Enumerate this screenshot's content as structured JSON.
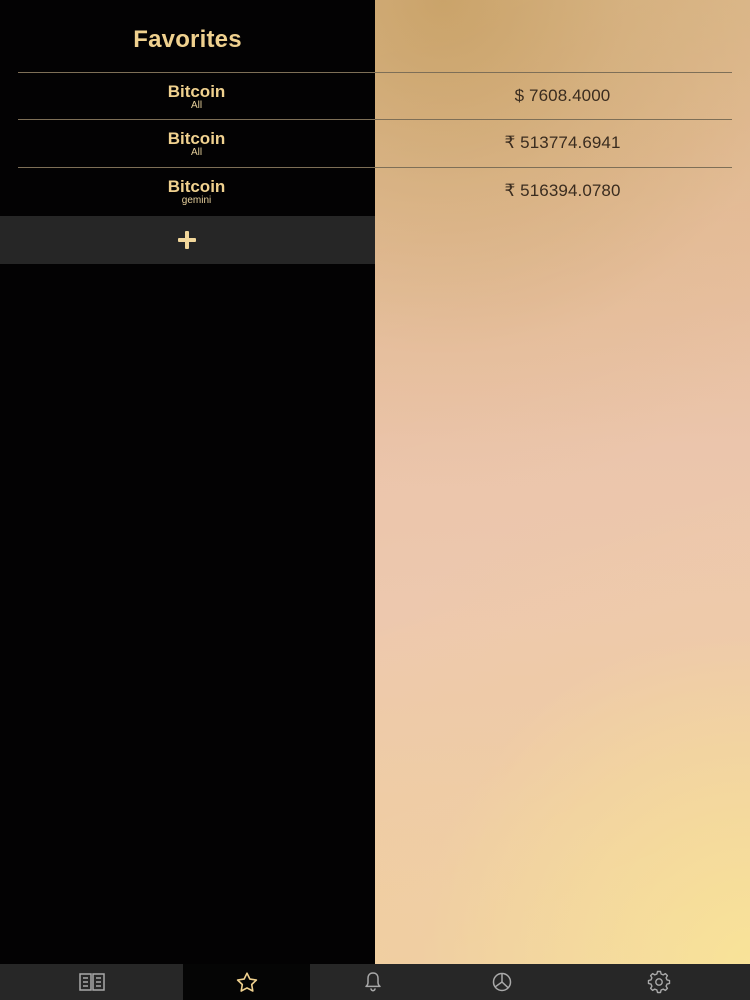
{
  "header": {
    "title": "Favorites"
  },
  "favorites": [
    {
      "coin": "Bitcoin",
      "exchange": "All",
      "price": "$ 7608.4000"
    },
    {
      "coin": "Bitcoin",
      "exchange": "All",
      "price": "₹ 513774.6941"
    },
    {
      "coin": "Bitcoin",
      "exchange": "gemini",
      "price": "₹ 516394.0780"
    }
  ],
  "actions": {
    "add_icon": "plus-icon"
  },
  "tabs": [
    {
      "icon": "book-icon",
      "active": false
    },
    {
      "icon": "star-icon",
      "active": true
    },
    {
      "icon": "bell-icon",
      "active": false
    },
    {
      "icon": "pie-chart-icon",
      "active": false
    },
    {
      "icon": "gear-icon",
      "active": false
    }
  ],
  "colors": {
    "accent": "#f0d18f",
    "panel_dark": "#030203",
    "tab_bar": "#272727",
    "active_tab": "#050505",
    "price_text": "#3a2c1f"
  }
}
